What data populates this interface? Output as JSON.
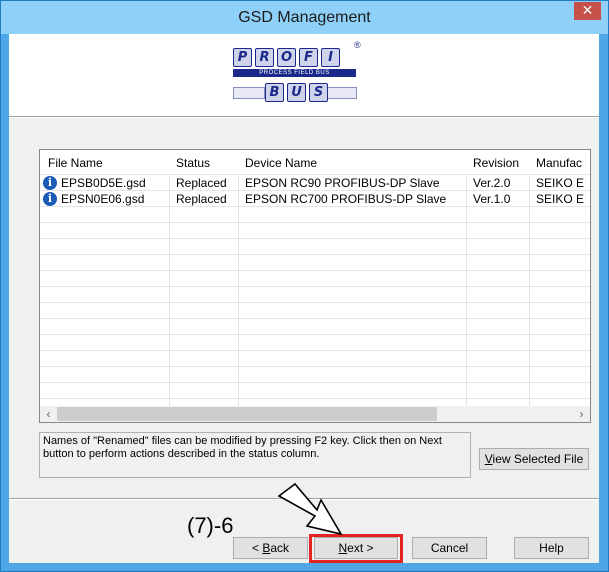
{
  "window": {
    "title": "GSD Management",
    "close_glyph": "✕"
  },
  "logo": {
    "letters_top": [
      "P",
      "R",
      "O",
      "F",
      "I"
    ],
    "strip_text": "PROCESS FIELD BUS",
    "letters_bottom": [
      "B",
      "U",
      "S"
    ],
    "reg_mark": "®"
  },
  "list": {
    "columns": [
      "File Name",
      "Status",
      "Device Name",
      "Revision",
      "Manufac"
    ],
    "rows": [
      {
        "icon": "info-icon",
        "file": "EPSB0D5E.gsd",
        "status": "Replaced",
        "device": "EPSON RC90 PROFIBUS-DP Slave",
        "revision": "Ver.2.0",
        "manufacturer": "SEIKO E"
      },
      {
        "icon": "info-icon",
        "file": "EPSN0E06.gsd",
        "status": "Replaced",
        "device": "EPSON RC700 PROFIBUS-DP Slave",
        "revision": "Ver.1.0",
        "manufacturer": "SEIKO E"
      }
    ]
  },
  "note": {
    "text": "Names of \"Renamed\" files can be modified by pressing F2 key. Click then on Next button to perform actions described in the status column."
  },
  "buttons": {
    "view_selected_u": "V",
    "view_selected_rest": "iew Selected File",
    "back_prefix": "< ",
    "back_u": "B",
    "back_rest": "ack",
    "next_u": "N",
    "next_rest": "ext >",
    "cancel": "Cancel",
    "help": "Help"
  },
  "annotation": {
    "label": "(7)-6",
    "highlight_color": "#e32222"
  }
}
